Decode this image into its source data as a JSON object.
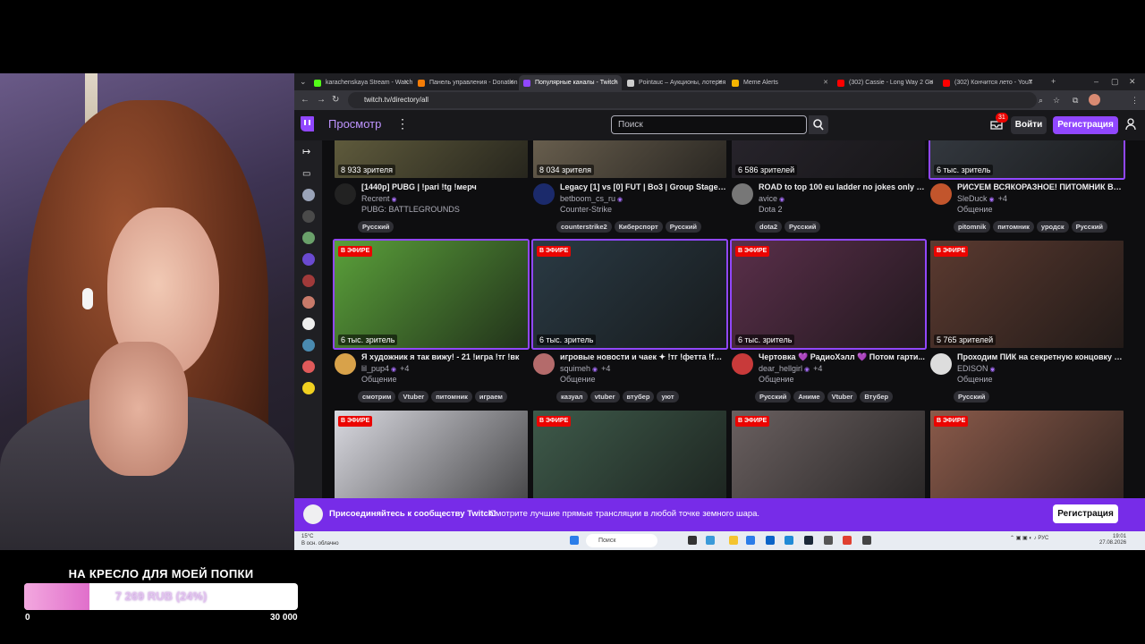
{
  "overlay": {
    "donation_title": "НА КРЕСЛО ДЛЯ МОЕЙ ПОПКИ",
    "donation_value": "7 269 RUB (24%)",
    "donation_fraction": 0.24,
    "donation_min": "0",
    "donation_max": "30 000"
  },
  "browser": {
    "tabs": [
      {
        "label": "karachenskaya Stream - Watch",
        "color": "#53fc18"
      },
      {
        "label": "Панель управления - Donation",
        "color": "#f57d07"
      },
      {
        "label": "Популярные каналы - Twitch",
        "color": "#9147ff"
      },
      {
        "label": "Pointauc – Аукционы, лотерея",
        "color": "#cccccc"
      },
      {
        "label": "Meme Alerts",
        "color": "#f5b400"
      },
      {
        "label": "(302) Cassie - Long Way 2 Go",
        "color": "#ff0000"
      },
      {
        "label": "(302) Кончится лето - YouT",
        "color": "#ff0000"
      }
    ],
    "url": "twitch.tv/directory/all"
  },
  "header": {
    "browse": "Просмотр",
    "search_placeholder": "Поиск",
    "notif_count": "31",
    "login": "Войти",
    "signup": "Регистрация"
  },
  "cards": [
    {
      "viewers": "8 933 зрителя",
      "title": "[1440p] PUBG | !pari !tg !мерч",
      "channel": "Recrent",
      "category": "PUBG: BATTLEGROUNDS",
      "tags": [
        "Русский"
      ],
      "live": false,
      "thumb": "#6f6a45",
      "avatar": "#222222"
    },
    {
      "viewers": "8 034 зрителя",
      "title": "Legacy [1] vs [0] FUT | Bo3 | Group Stage ...",
      "channel": "betboom_cs_ru",
      "category": "Counter-Strike",
      "tags": [
        "counterstrike2",
        "Киберспорт",
        "Русский"
      ],
      "live": false,
      "thumb": "#7a6e5a",
      "avatar": "#1b2a6b"
    },
    {
      "viewers": "6 586 зрителей",
      "title": "ROAD to top 100 eu ladder no jokes only tr...",
      "channel": "avice",
      "category": "Dota 2",
      "tags": [
        "dota2",
        "Русский"
      ],
      "live": false,
      "thumb": "#2b2730",
      "avatar": "#777777"
    },
    {
      "viewers": "6 тыс. зритель",
      "title": "РИСУЕМ ВСЯКОРАЗНОЕ! ПИТОМНИК В И...",
      "channel": "SleDuck",
      "category": "Общение",
      "tags": [
        "pitomnik",
        "питомник",
        "уродск",
        "Русский"
      ],
      "live": false,
      "thumb": "#3a4048",
      "avatar": "#c2552c",
      "extra": "+4"
    },
    {
      "viewers": "6 тыс. зритель",
      "title": "Я художник я так вижу! - 21 !игра !тг !вк",
      "channel": "lil_pup4",
      "category": "Общение",
      "tags": [
        "смотрим",
        "Vtuber",
        "питомник",
        "играем"
      ],
      "live": true,
      "thumb": "#5aa03a",
      "avatar": "#d8a24a",
      "extra": "+4"
    },
    {
      "viewers": "6 тыс. зритель",
      "title": "игровые новости и чаек ✦ !тг !фетта !fun...",
      "channel": "squimeh",
      "category": "Общение",
      "tags": [
        "казуал",
        "vtuber",
        "втубер",
        "уют"
      ],
      "live": true,
      "thumb": "#2a3a44",
      "avatar": "#b46b6b",
      "extra": "+4"
    },
    {
      "viewers": "6 тыс. зритель",
      "title": "Чертовка 💜 РадиоХэлл 💜 Потом гарти...",
      "channel": "dear_hellgirl",
      "category": "Общение",
      "tags": [
        "Русский",
        "Аниме",
        "Vtuber",
        "Втубер"
      ],
      "live": true,
      "thumb": "#5a2f4a",
      "avatar": "#c83a3a",
      "extra": "+4"
    },
    {
      "viewers": "5 765 зрителей",
      "title": "Проходим ПИК на секретную концовку | ...",
      "channel": "EDISON",
      "category": "Общение",
      "tags": [
        "Русский"
      ],
      "live": true,
      "thumb": "#5b3a30",
      "avatar": "#dddddd"
    },
    {
      "viewers": "",
      "title": "",
      "channel": "",
      "category": "",
      "tags": [],
      "live": true,
      "thumb": "#d9d9e0",
      "avatar": "#000000"
    },
    {
      "viewers": "",
      "title": "",
      "channel": "",
      "category": "",
      "tags": [],
      "live": true,
      "thumb": "#3e5a4a",
      "avatar": "#000000"
    },
    {
      "viewers": "",
      "title": "",
      "channel": "",
      "category": "",
      "tags": [],
      "live": true,
      "thumb": "#6a6060",
      "avatar": "#000000"
    },
    {
      "viewers": "",
      "title": "",
      "channel": "",
      "category": "",
      "tags": [],
      "live": true,
      "thumb": "#8a5a4a",
      "avatar": "#000000"
    }
  ],
  "live_label": "В ЭФИРЕ",
  "banner": {
    "bold": "Присоединяйтесь к сообществу Twitch!",
    "text": "Смотрите лучшие прямые трансляции в любой точке земного шара.",
    "button": "Регистрация"
  },
  "taskbar": {
    "weather_temp": "15°C",
    "weather_desc": "В осн. облачно",
    "search": "Поиск",
    "lang": "РУС",
    "time": "19:01",
    "date": "27.08.2026"
  }
}
